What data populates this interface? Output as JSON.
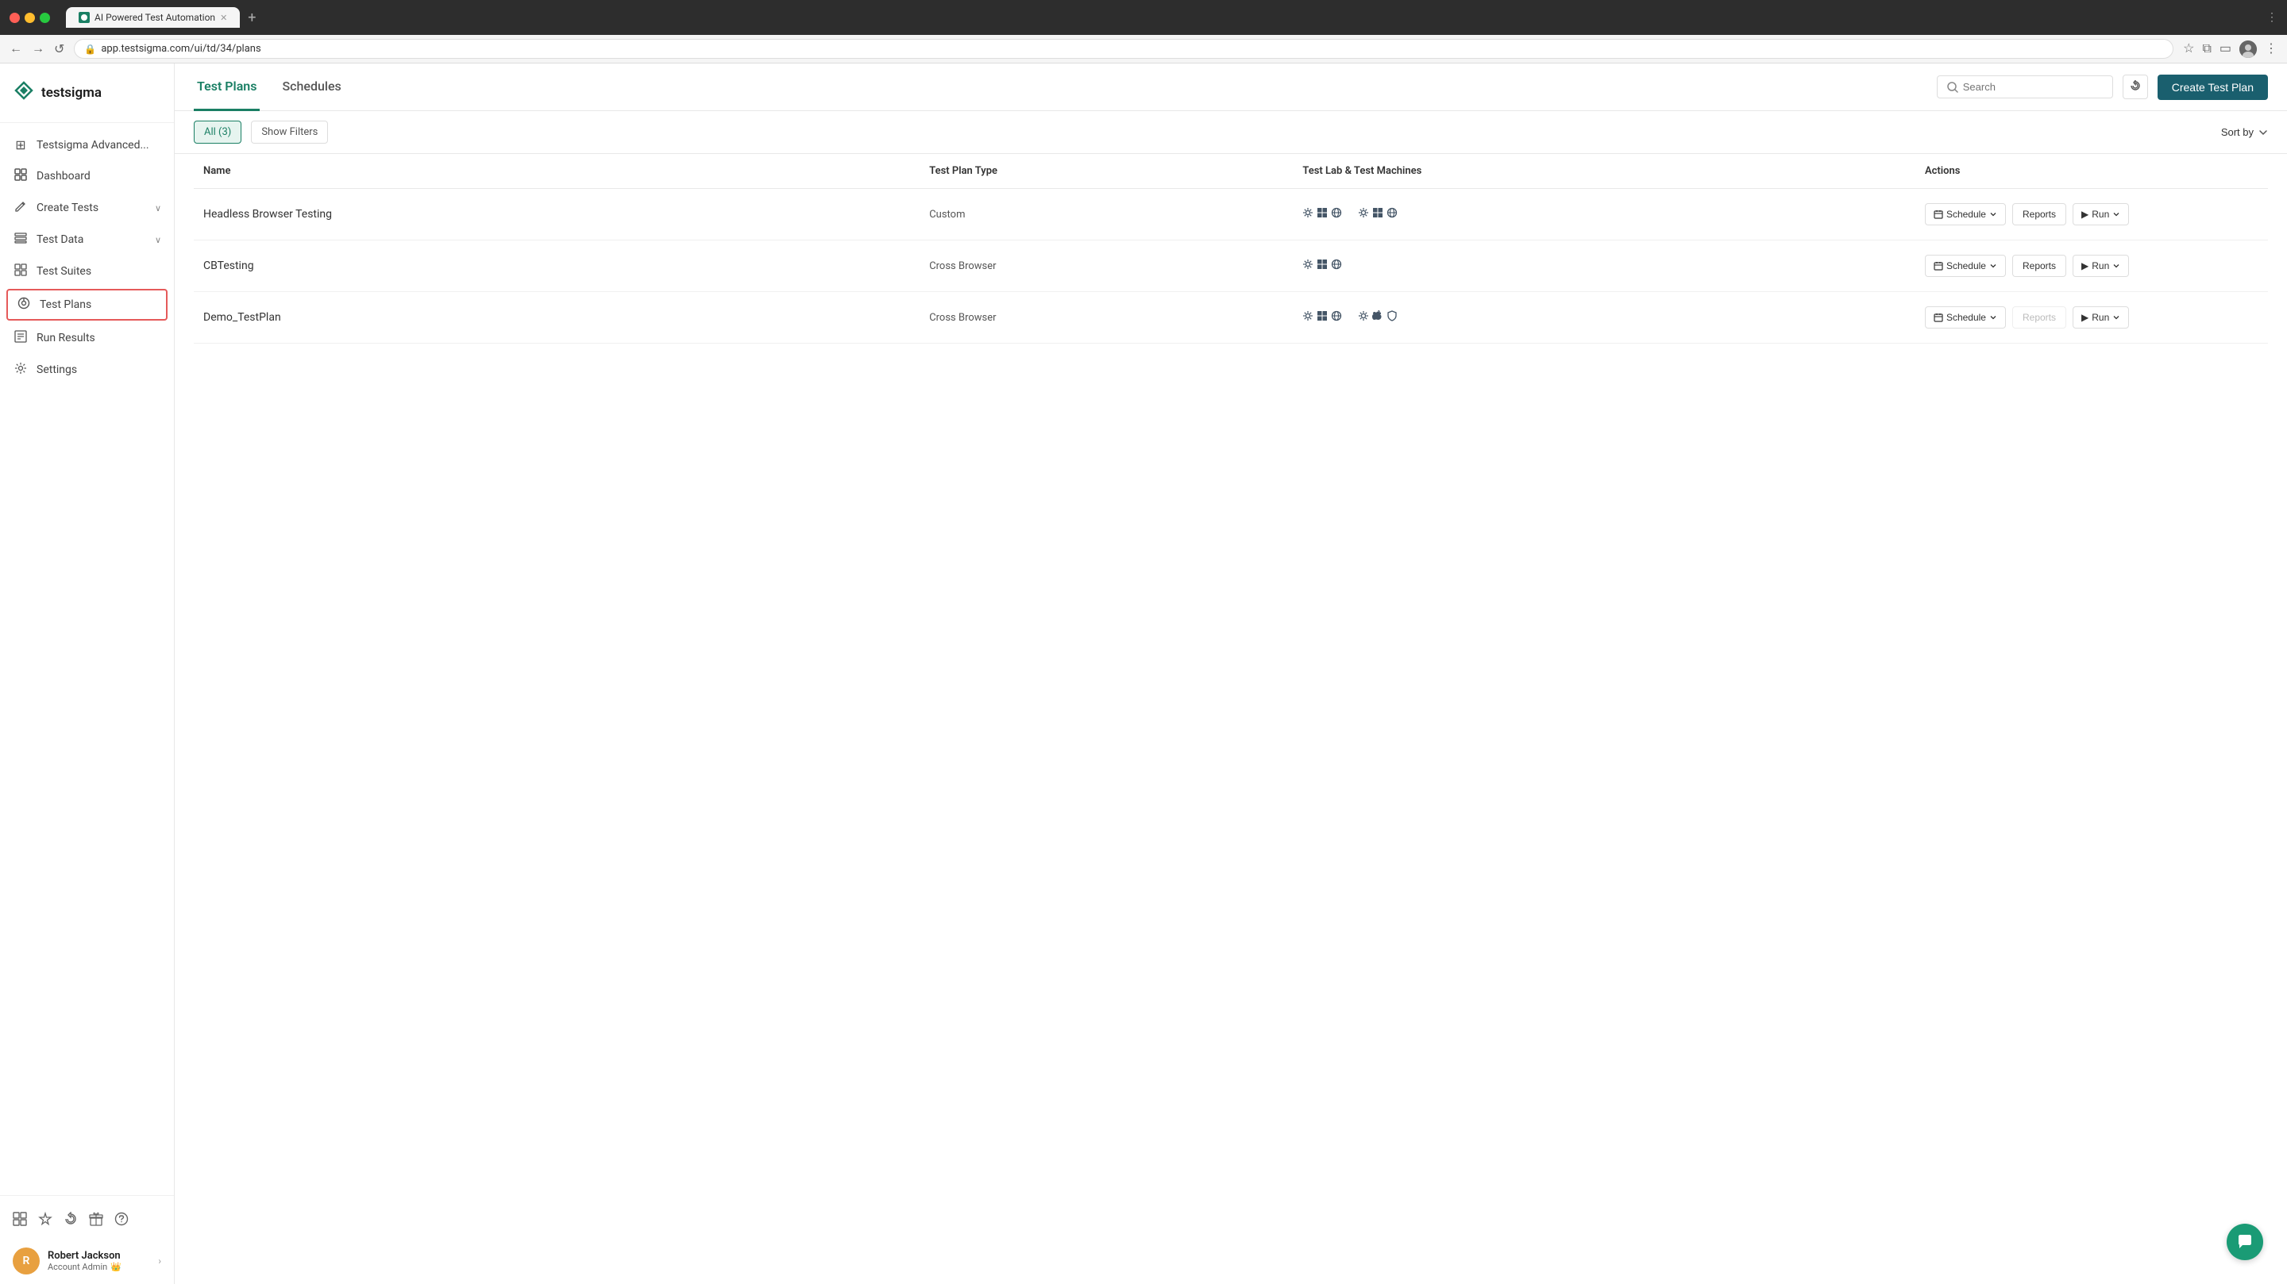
{
  "browser": {
    "tab_title": "AI Powered Test Automation",
    "tab_active": true,
    "url": "app.testsigma.com/ui/td/34/plans"
  },
  "logo": {
    "text": "testsigma"
  },
  "sidebar": {
    "app_name": "Testsigma Advanced...",
    "items": [
      {
        "id": "apps",
        "label": "Testsigma Advanced...",
        "icon": "⊞",
        "has_chevron": false
      },
      {
        "id": "dashboard",
        "label": "Dashboard",
        "icon": "◫",
        "has_chevron": false
      },
      {
        "id": "create-tests",
        "label": "Create Tests",
        "icon": "✏",
        "has_chevron": true
      },
      {
        "id": "test-data",
        "label": "Test Data",
        "icon": "▤",
        "has_chevron": true
      },
      {
        "id": "test-suites",
        "label": "Test Suites",
        "icon": "⊞",
        "has_chevron": false
      },
      {
        "id": "test-plans",
        "label": "Test Plans",
        "icon": "⊙",
        "has_chevron": false,
        "active": true
      },
      {
        "id": "run-results",
        "label": "Run Results",
        "icon": "▦",
        "has_chevron": false
      },
      {
        "id": "settings",
        "label": "Settings",
        "icon": "⚙",
        "has_chevron": false
      }
    ],
    "bottom_icons": [
      "⊞",
      "✦",
      "↺",
      "▤",
      "?"
    ],
    "user": {
      "initial": "R",
      "name": "Robert Jackson",
      "role": "Account Admin",
      "role_badge": "👑"
    }
  },
  "header": {
    "tabs": [
      {
        "id": "test-plans",
        "label": "Test Plans",
        "active": true
      },
      {
        "id": "schedules",
        "label": "Schedules",
        "active": false
      }
    ],
    "search_placeholder": "Search",
    "create_button": "Create Test Plan"
  },
  "filters": {
    "all_label": "All (3)",
    "show_filters": "Show Filters",
    "sort_by": "Sort by"
  },
  "table": {
    "columns": [
      "Name",
      "Test Plan Type",
      "Test Lab & Test Machines",
      "Actions"
    ],
    "rows": [
      {
        "name": "Headless Browser Testing",
        "type": "Custom",
        "machines": [
          [
            "⚙",
            "⊞",
            "☊"
          ],
          [
            "⚙",
            "⊞",
            "☊"
          ]
        ],
        "reports_disabled": false
      },
      {
        "name": "CBTesting",
        "type": "Cross Browser",
        "machines": [
          [
            "⚙",
            "⊞",
            "☊"
          ]
        ],
        "reports_disabled": false
      },
      {
        "name": "Demo_TestPlan",
        "type": "Cross Browser",
        "machines": [
          [
            "⚙",
            "⊞",
            "☊"
          ],
          [
            "⚙",
            "🍎",
            "◎"
          ]
        ],
        "reports_disabled": true
      }
    ],
    "actions": {
      "schedule": "Schedule",
      "reports": "Reports",
      "run": "Run"
    }
  }
}
